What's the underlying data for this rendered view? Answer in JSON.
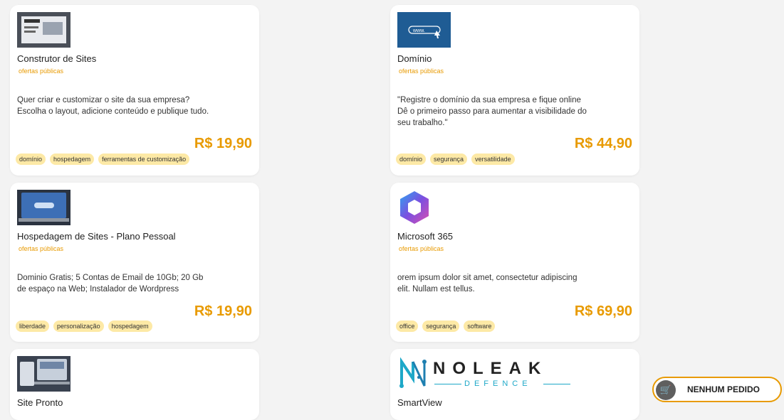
{
  "offer_label": "ofertas públicas",
  "products": [
    {
      "title": "Construtor de Sites",
      "description": "Quer criar e customizar o site da sua empresa? Escolha o layout, adicione conteúdo e publique tudo.",
      "price": "R$ 19,90",
      "tags": [
        "domínio",
        "hospedagem",
        "ferramentas de customização"
      ]
    },
    {
      "title": "Domínio",
      "description": "\"Registre o domínio da sua empresa e fique online Dê o primeiro passo para aumentar a visibilidade do seu trabalho.\"",
      "price": "R$ 44,90",
      "tags": [
        "domínio",
        "segurança",
        "versatilidade"
      ],
      "thumb_text": "www."
    },
    {
      "title": "Hospedagem de Sites - Plano Pessoal",
      "description": "Dominio Gratis; 5 Contas de Email de 10Gb; 20 Gb de espaço na Web; Instalador de Wordpress",
      "price": "R$ 19,90",
      "tags": [
        "liberdade",
        "personalização",
        "hospedagem"
      ]
    },
    {
      "title": "Microsoft 365",
      "description": "orem ipsum dolor sit amet, consectetur adipiscing elit. Nullam est tellus.",
      "price": "R$ 69,90",
      "tags": [
        "office",
        "segurança",
        "software"
      ]
    },
    {
      "title": "Site Pronto"
    },
    {
      "title": "SmartView",
      "logo_text": "NOLEAK",
      "logo_sub": "DEFENCE"
    }
  ],
  "cart": {
    "label": "NENHUM PEDIDO"
  },
  "colors": {
    "accent": "#e89a00",
    "tag_bg": "#fde9a6"
  }
}
